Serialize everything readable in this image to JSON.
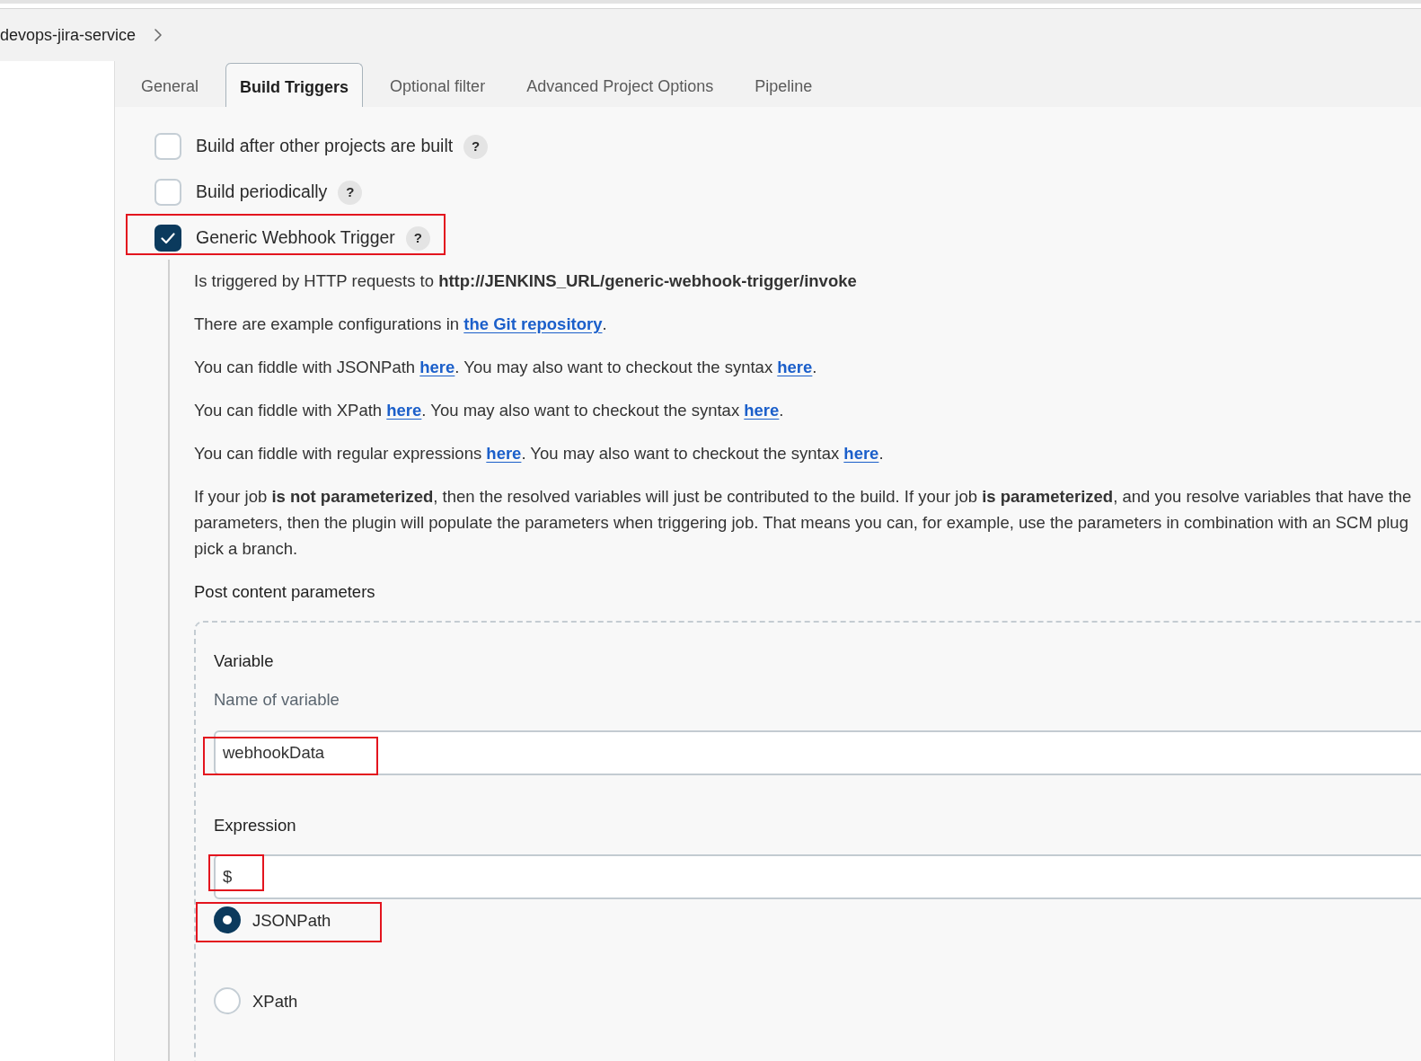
{
  "breadcrumb": [
    {
      "label": "devops-jira-service"
    }
  ],
  "tabs": [
    {
      "label": "General",
      "selected": false
    },
    {
      "label": "Build Triggers",
      "selected": true
    },
    {
      "label": "Optional filter",
      "selected": false
    },
    {
      "label": "Advanced Project Options",
      "selected": false
    },
    {
      "label": "Pipeline",
      "selected": false
    }
  ],
  "triggers": [
    {
      "label": "Build after other projects are built",
      "checked": false,
      "help": "?",
      "highlighted": false
    },
    {
      "label": "Build periodically",
      "checked": false,
      "help": "?",
      "highlighted": false
    },
    {
      "label": "Generic Webhook Trigger",
      "checked": true,
      "help": "?",
      "highlighted": true
    }
  ],
  "webhook_trigger": {
    "paragraphs": [
      {
        "parts": [
          {
            "kind": "text",
            "text": "Is triggered by HTTP requests to **http://JENKINS_URL/generic-webhook-trigger/invoke**"
          }
        ]
      },
      {
        "parts": [
          {
            "kind": "text",
            "text": "There are example configurations in "
          },
          {
            "kind": "link",
            "text": "the Git repository"
          },
          {
            "kind": "text",
            "text": "."
          }
        ]
      },
      {
        "parts": [
          {
            "kind": "text",
            "text": "You can fiddle with JSONPath "
          },
          {
            "kind": "link",
            "text": "here"
          },
          {
            "kind": "text",
            "text": ". You may also want to checkout the syntax "
          },
          {
            "kind": "link",
            "text": "here"
          },
          {
            "kind": "text",
            "text": "."
          }
        ]
      },
      {
        "parts": [
          {
            "kind": "text",
            "text": "You can fiddle with XPath "
          },
          {
            "kind": "link",
            "text": "here"
          },
          {
            "kind": "text",
            "text": ". You may also want to checkout the syntax "
          },
          {
            "kind": "link",
            "text": "here"
          },
          {
            "kind": "text",
            "text": "."
          }
        ]
      },
      {
        "parts": [
          {
            "kind": "text",
            "text": "You can fiddle with regular expressions "
          },
          {
            "kind": "link",
            "text": "here"
          },
          {
            "kind": "text",
            "text": ". You may also want to checkout the syntax "
          },
          {
            "kind": "link",
            "text": "here"
          },
          {
            "kind": "text",
            "text": "."
          }
        ]
      },
      {
        "parts": [
          {
            "kind": "text",
            "text": "If your job **is not parameterized**, then the resolved variables will just be contributed to the build. If your job **is parameterized**, and you resolve variables that have the"
          },
          {
            "kind": "break"
          },
          {
            "kind": "text",
            "text": "parameters, then the plugin will populate the parameters when triggering job. That means you can, for example, use the parameters in combination with an SCM plug"
          },
          {
            "kind": "break"
          },
          {
            "kind": "text",
            "text": "pick a branch."
          }
        ]
      }
    ],
    "section_title": "Post content parameters",
    "parameters": [
      {
        "variable_label": "Variable",
        "variable_description": "Name of variable",
        "variable_field": {
          "value": "webhookData",
          "highlighted": true
        },
        "expression_label": "Expression",
        "expression_field": {
          "value": "$",
          "highlighted": true
        },
        "expression_types": [
          {
            "label": "JSONPath",
            "selected": true,
            "highlighted": true
          },
          {
            "label": "XPath",
            "selected": false,
            "highlighted": false
          }
        ]
      }
    ]
  }
}
